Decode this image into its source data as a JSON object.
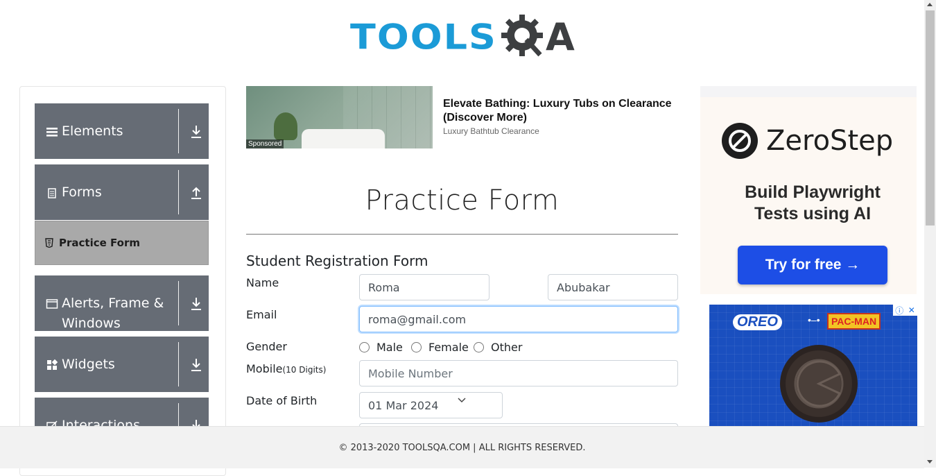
{
  "header": {
    "logo_text_primary": "TOOLS",
    "logo_text_secondary": "QA"
  },
  "sidebar": {
    "groups": [
      {
        "label": "Elements",
        "icon": "hamburger-icon",
        "arrow": "download-icon"
      },
      {
        "label": "Forms",
        "icon": "document-icon",
        "arrow": "upload-icon"
      },
      {
        "label": "Alerts, Frame & Windows",
        "icon": "window-icon",
        "arrow": "download-icon"
      },
      {
        "label": "Widgets",
        "icon": "widgets-icon",
        "arrow": "download-icon"
      },
      {
        "label": "Interactions",
        "icon": "interactions-icon",
        "arrow": "download-icon"
      }
    ],
    "active_item": {
      "label": "Practice Form",
      "icon": "html5-icon"
    }
  },
  "sponsored_ad": {
    "badge": "Sponsored",
    "title": "Elevate Bathing: Luxury Tubs on Clearance (Discover More)",
    "source": "Luxury Bathtub Clearance"
  },
  "form": {
    "page_title": "Practice Form",
    "heading": "Student Registration Form",
    "name_label": "Name",
    "first_name_value": "Roma",
    "last_name_value": "Abubakar",
    "email_label": "Email",
    "email_value": "roma@gmail.com",
    "gender_label": "Gender",
    "gender_options": [
      "Male",
      "Female",
      "Other"
    ],
    "mobile_label": "Mobile",
    "mobile_hint": "(10 Digits)",
    "mobile_placeholder": "Mobile Number",
    "dob_label": "Date of Birth",
    "dob_value": "01 Mar 2024"
  },
  "ad_zerostep": {
    "brand": "ZeroStep",
    "tagline_line1": "Build Playwright",
    "tagline_line2": "Tests using AI",
    "button": "Try for free →",
    "accent": "#1d4ee6"
  },
  "ad_oreo": {
    "brand": "OREO",
    "dots": "•–•",
    "partner": "PAC-MAN",
    "info_icon": "info-icon",
    "close_icon": "close-icon"
  },
  "footer": {
    "text": "© 2013-2020 TOOLSQA.COM | ALL RIGHTS RESERVED."
  },
  "colors": {
    "sidebar_bg": "#666c75",
    "active_item_bg": "#a9a9a9",
    "logo_blue": "#1b9bd7",
    "logo_dark": "#3d3f41"
  }
}
